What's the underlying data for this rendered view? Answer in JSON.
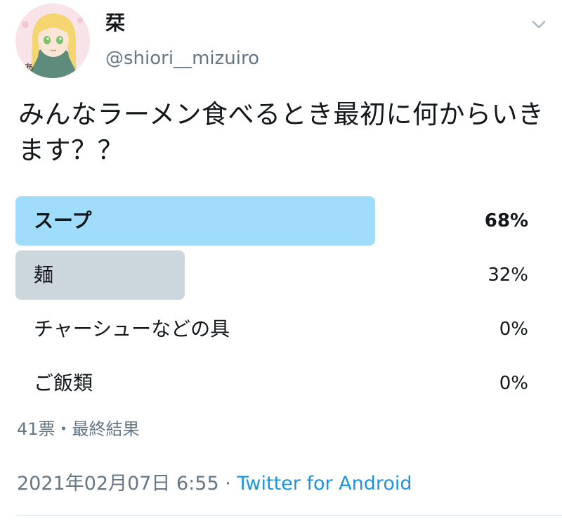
{
  "tweet": {
    "author": {
      "display_name": "栞",
      "handle": "@shiori__mizuiro",
      "avatar_icon": "anime-girl-avatar"
    },
    "menu_icon": "chevron-down-icon",
    "text": "みんなラーメン食べるとき最初に何からいきます？？",
    "poll": {
      "options": [
        {
          "label": "スープ",
          "percent_text": "68%",
          "percent": 68,
          "color": "#a0dcfb",
          "winner": true
        },
        {
          "label": "麺",
          "percent_text": "32%",
          "percent": 32,
          "color": "#ccd6dd",
          "winner": false
        },
        {
          "label": "チャーシューなどの具",
          "percent_text": "0%",
          "percent": 0,
          "color": "#ccd6dd",
          "winner": false
        },
        {
          "label": "ご飯類",
          "percent_text": "0%",
          "percent": 0,
          "color": "#ccd6dd",
          "winner": false
        }
      ],
      "meta": "41票・最終結果"
    },
    "timestamp": "2021年02月07日 6:55",
    "separator": " · ",
    "source": "Twitter for Android"
  },
  "colors": {
    "winner_bar": "#a0dcfb",
    "other_bar": "#ccd6dd",
    "secondary_text": "#657786",
    "link": "#1b95e0"
  }
}
